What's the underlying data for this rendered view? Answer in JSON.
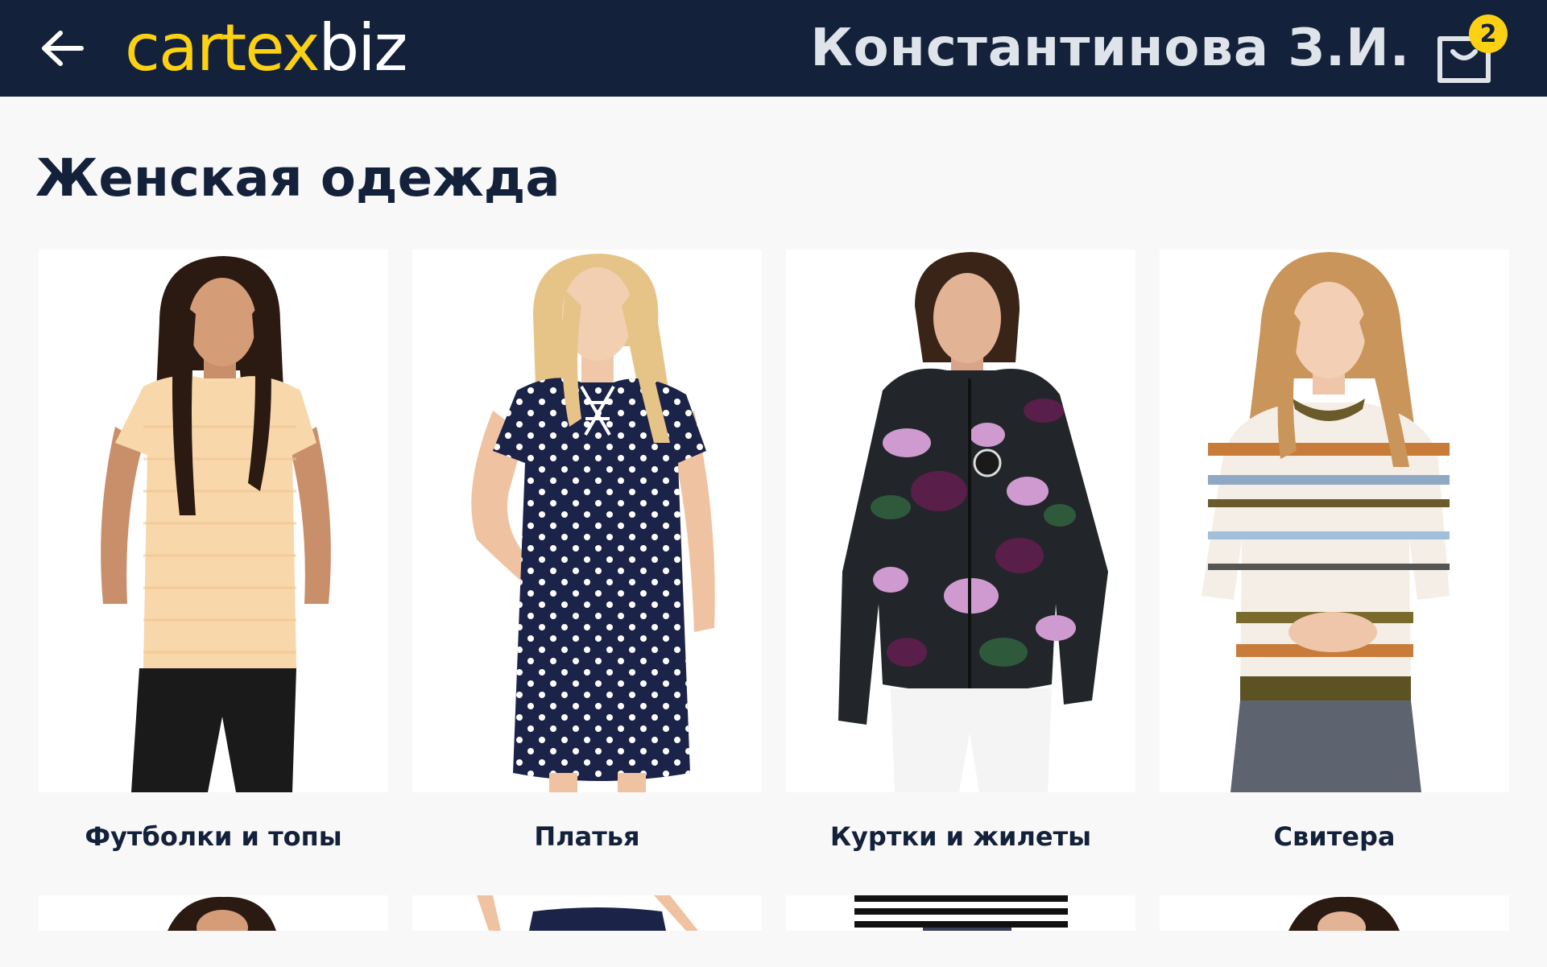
{
  "header": {
    "logo_part1": "cartex",
    "logo_part2": "biz",
    "user_name": "Константинова З.И.",
    "cart_count": "2",
    "colors": {
      "bar": "#13213b",
      "accent": "#fcd114"
    }
  },
  "page": {
    "title": "Женская одежда"
  },
  "categories": [
    {
      "label": "Футболки и топы",
      "image_icon": "woman-tshirt-image"
    },
    {
      "label": "Платья",
      "image_icon": "woman-dress-image"
    },
    {
      "label": "Куртки и жилеты",
      "image_icon": "woman-jacket-image"
    },
    {
      "label": "Свитера",
      "image_icon": "woman-sweater-image"
    }
  ],
  "next_row_cards": [
    {
      "image_icon": "woman-portrait-image"
    },
    {
      "image_icon": "navy-garment-image"
    },
    {
      "image_icon": "striped-top-image"
    },
    {
      "image_icon": "woman-portrait-image"
    }
  ]
}
